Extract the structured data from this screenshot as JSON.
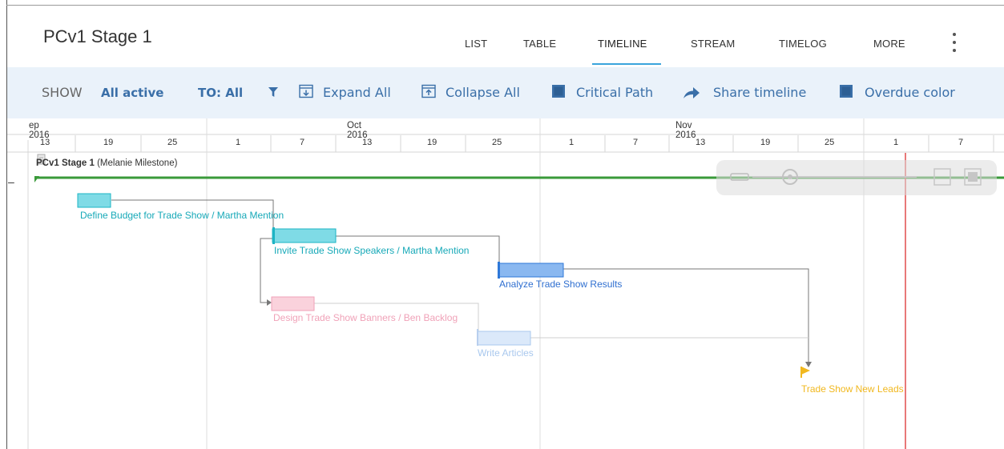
{
  "header": {
    "title": "PCv1 Stage 1",
    "tabs": [
      {
        "label": "LIST"
      },
      {
        "label": "TABLE"
      },
      {
        "label": "TIMELINE"
      },
      {
        "label": "STREAM"
      },
      {
        "label": "TIMELOG"
      },
      {
        "label": "MORE"
      }
    ],
    "active_tab": "TIMELINE"
  },
  "toolbar": {
    "show_label": "SHOW",
    "show_value": "All active",
    "to_label": "TO: All",
    "expand_all": "Expand All",
    "collapse_all": "Collapse All",
    "critical_path": "Critical Path",
    "share_timeline": "Share timeline",
    "overdue_color": "Overdue color",
    "icons": [
      "filter-icon",
      "expand-all-icon",
      "collapse-all-icon",
      "critical-path-checkbox-icon",
      "share-arrow-icon",
      "overdue-color-checkbox-icon"
    ]
  },
  "timeline": {
    "months": [
      "ep 2016",
      "Oct 2016",
      "Nov 2016"
    ],
    "days": [
      "13",
      "19",
      "25",
      "1",
      "7",
      "13",
      "19",
      "25",
      "1",
      "7",
      "13",
      "19",
      "25",
      "1",
      "7"
    ],
    "project": {
      "name": "PCv1 Stage 1",
      "owner": "(Melanie Milestone)"
    },
    "collapse_symbol": "–",
    "tasks": [
      {
        "label": "Define Budget for Trade Show  / Martha Mention",
        "color": "#1eb4c4"
      },
      {
        "label": "Invite Trade Show  Speakers / Martha Mention",
        "color": "#1eb4c4"
      },
      {
        "label": "Analyze Trade Show  Results",
        "color": "#2f78d8"
      },
      {
        "label": "Design Trade Show  Banners / Ben Backlog",
        "color": "#f0a2b8"
      },
      {
        "label": "Write Articles",
        "color": "#a9c8ee"
      },
      {
        "label": "Trade Show New Leads",
        "color": "#f1b81f"
      }
    ],
    "colors": {
      "project_bar": "#3a9a3a",
      "today_line": "#e25656",
      "grid": "#e3e3e3",
      "accent": "#3a6fa8",
      "toolbar_bg": "#eaf2fa"
    }
  }
}
